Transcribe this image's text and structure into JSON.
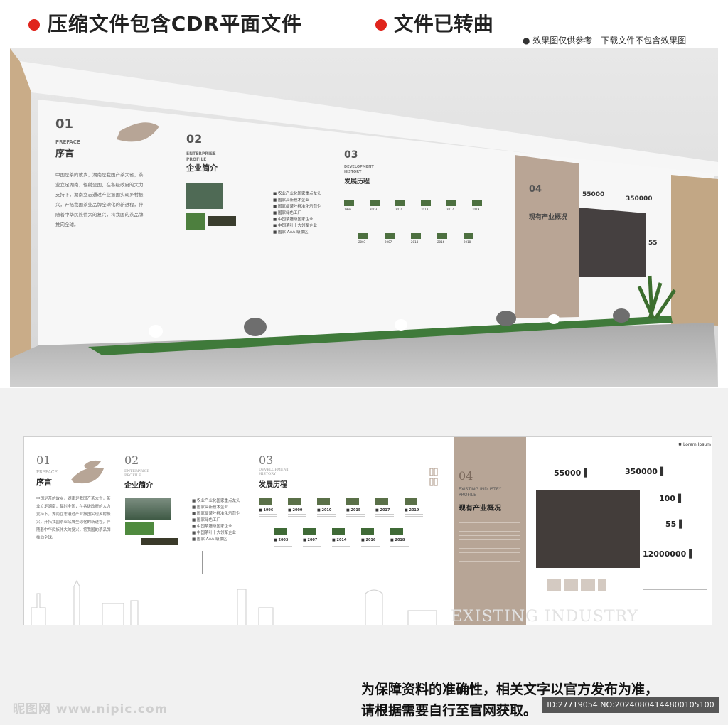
{
  "banner": {
    "title_left": "压缩文件包含CDR平面文件",
    "title_right": "文件已转曲",
    "note": "● 效果图仅供参考　下载文件不包含效果图"
  },
  "colors": {
    "accent_red": "#e0241c",
    "wall_tan": "#b7a596",
    "wood": "#c2a785",
    "screen": "#433d3a"
  },
  "sections": {
    "preface": {
      "num": "01",
      "en": "PREFACE",
      "cn": "序言",
      "body": [
        "中国是茶的故乡，湖南是我国产茶大省，茶",
        "业立足湖南，辐射全国，在各级政府的大力",
        "支持下，湖南立志通过产业振国实现乡村振",
        "兴，开拓我国茶业品牌全球化的新进程，伴",
        "随着中华民族伟大的复兴，将我国的茶品牌",
        "推向全球。"
      ]
    },
    "profile": {
      "num": "02",
      "en1": "ENTERPRISE",
      "en2": "PROFILE",
      "cn": "企业简介",
      "items": [
        "农业产业化国家重点龙头",
        "国家高新技术企业",
        "国家级茶叶标准化示范企",
        "国家绿色工厂",
        "中国茶膳级国家企业",
        "中国茶叶十大领军企业",
        "国家 AAA 级景区"
      ]
    },
    "history": {
      "num": "03",
      "en1": "DEVELOPMENT",
      "en2": "HISTORY",
      "cn": "发展历程",
      "years_top": [
        "1996",
        "2000",
        "2010",
        "2015",
        "2017",
        "2019"
      ],
      "years_bottom": [
        "2003",
        "2007",
        "2014",
        "2016",
        "2018"
      ],
      "years_render_top": [
        "1996",
        "2003",
        "2010",
        "2013",
        "2017",
        "2019"
      ],
      "years_render_bottom": [
        "2003",
        "2007",
        "2014",
        "2016",
        "2018"
      ]
    },
    "industry": {
      "num": "04",
      "en1": "EXISTING INDUSTRY",
      "en2": "PROFILE",
      "cn": "现有产业概况",
      "big_en": "EXISTING INDUSTRY"
    },
    "stats": [
      {
        "value": "55000"
      },
      {
        "value": "350000"
      },
      {
        "value": "100"
      },
      {
        "value": "55"
      },
      {
        "value": "12000000"
      }
    ],
    "stats_render": [
      "55000",
      "350000",
      "55"
    ],
    "logo": "Lorem Ipsum"
  },
  "bottom": {
    "line1": "为保障资料的准确性，相关文字以官方发布为准，",
    "line2": "请根据需要自行至官网获取。",
    "watermark": "昵图网 www.nipic.com",
    "id_text": "ID:27719054 NO:20240804144800105100"
  }
}
